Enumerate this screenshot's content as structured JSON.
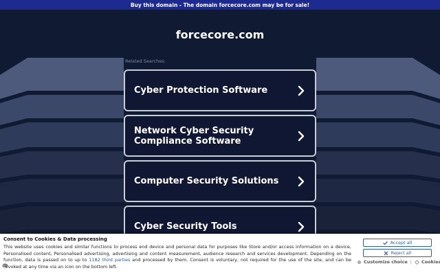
{
  "topbar": {
    "text": "Buy this domain - The domain forcecore.com may be for sale!"
  },
  "page": {
    "domain": "forcecore.com",
    "related_label": "Related Searches:"
  },
  "results": [
    {
      "label": "Cyber Protection Software"
    },
    {
      "label": "Network Cyber Security Compliance Software"
    },
    {
      "label": "Computer Security Solutions"
    },
    {
      "label": "Cyber Security Tools"
    }
  ],
  "consent": {
    "title": "Consent to Cookies & Data processing",
    "text_before_link": "This website uses cookies and similar functions to process end device and personal data for purposes like Store and/or access information on a device, Personalised content, Personalised advertising, advertising and content measurement, audience research and services development. Depending on the function, data is passed on to up to ",
    "link_text": "1182 third parties",
    "text_after_link": " and processed by them. Consent is voluntary, not required for the use of the site, and can be revoked at any time via an icon on the bottom left.",
    "accept_label": "Accept all",
    "reject_label": "Reject all",
    "customize_label": "Customize choice",
    "separator": "|",
    "cookies_label": "Cookies"
  },
  "colors": {
    "background": "#111a33",
    "topbar": "#1d2a8f",
    "card_border": "#c9cdd6",
    "accent_blue": "#2c5db3"
  },
  "icons": {
    "card_arrow": "chevron-right-icon",
    "accept": "check-icon",
    "reject": "x-icon",
    "customize": "gear-icon",
    "cookies": "diamond-icon",
    "revoke": "fingerprint-icon"
  }
}
